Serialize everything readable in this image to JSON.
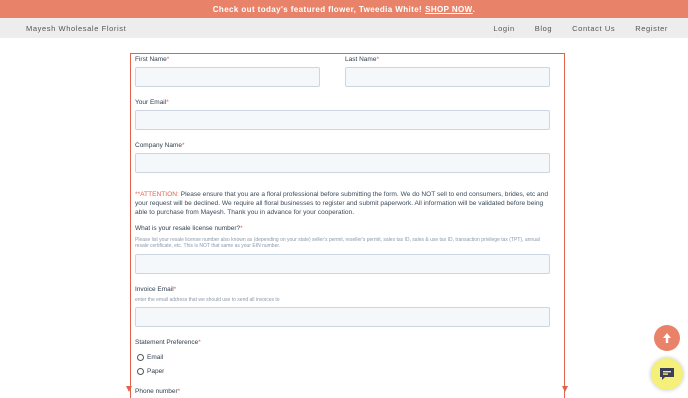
{
  "promo": {
    "text": "Check out today's featured flower, Tweedia White!",
    "link": "SHOP NOW",
    "end": "."
  },
  "nav": {
    "brand": "Mayesh Wholesale Florist",
    "links": [
      "Login",
      "Blog",
      "Contact Us",
      "Register"
    ]
  },
  "form": {
    "first_name": "First Name",
    "last_name": "Last Name",
    "email": "Your Email",
    "company": "Company Name",
    "required_mark": "*",
    "attention_label": "**ATTENTION:",
    "attention_text": " Please ensure that you are a floral professional before submitting the form. We do NOT sell to end consumers, brides, etc and your request will be declined. We require all floral businesses to register and submit paperwork. All information will be validated before being able to purchase from Mayesh. Thank you in advance for your cooperation.",
    "resale_label": "What is your resale license number?",
    "resale_help": "Please list your resale license number also known as (depending on your state) seller's permit, reseller's permit, sales tax ID, sales & use tax ID, transaction privilege tax (TPT), annual resale certificate, etc. This is NOT that same as your EIN number.",
    "invoice_label": "Invoice Email",
    "invoice_help": "enter the email address that we should use to send all invoices to",
    "statement_label": "Statement Preference",
    "statement_options": [
      "Email",
      "Paper"
    ],
    "phone_label": "Phone number"
  },
  "icons": {
    "scroll_top": "arrow-up-icon",
    "chat": "chat-bubble-icon"
  },
  "colors": {
    "accent": "#e8836a",
    "outline": "#e2614a",
    "chat": "#f4f07a"
  }
}
